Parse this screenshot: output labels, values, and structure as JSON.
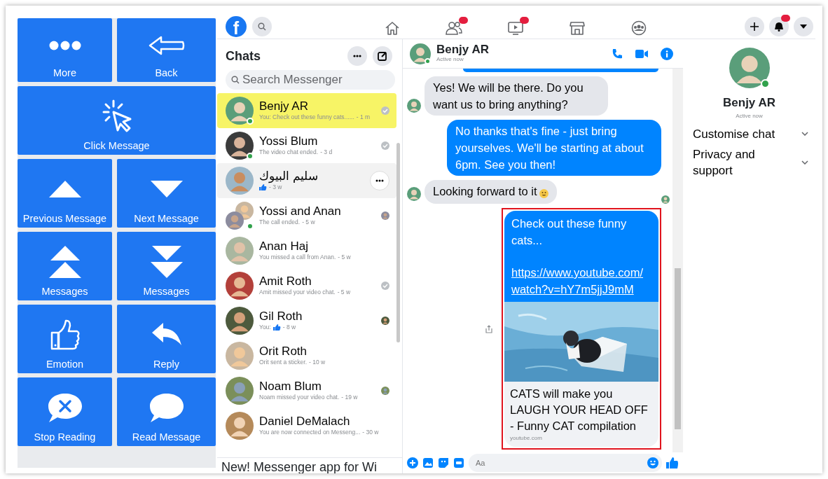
{
  "tool_panel": {
    "buttons": [
      {
        "label": "More",
        "kind": "more"
      },
      {
        "label": "Back",
        "kind": "back"
      },
      {
        "label": "Click Message",
        "kind": "click"
      },
      {
        "label": "Previous Message",
        "kind": "up"
      },
      {
        "label": "Next Message",
        "kind": "down"
      },
      {
        "label": "Messages",
        "kind": "top"
      },
      {
        "label": "Messages",
        "kind": "bottom"
      },
      {
        "label": "Emotion",
        "kind": "like"
      },
      {
        "label": "Reply",
        "kind": "reply"
      },
      {
        "label": "Stop Reading",
        "kind": "stop"
      },
      {
        "label": "Read Message",
        "kind": "read"
      }
    ]
  },
  "top_nav": {
    "logo_text": "f",
    "items": [
      {
        "kind": "home",
        "badge": false
      },
      {
        "kind": "friends",
        "badge": true
      },
      {
        "kind": "watch",
        "badge": true
      },
      {
        "kind": "marketplace",
        "badge": false
      },
      {
        "kind": "groups",
        "badge": false
      }
    ],
    "actions": [
      {
        "kind": "plus",
        "badge": false
      },
      {
        "kind": "bell",
        "badge": true
      },
      {
        "kind": "caret",
        "badge": false
      }
    ]
  },
  "chats": {
    "title": "Chats",
    "search": {
      "placeholder": "Search Messenger"
    },
    "items": [
      {
        "name": "Benjy AR",
        "preview": "You: Check out these funny cats......",
        "like": false,
        "time": "- 1 m",
        "selected": true,
        "hovered": false,
        "online": true,
        "kind": "person",
        "receipt": {
          "kind": "check"
        }
      },
      {
        "name": "Yossi Blum",
        "preview": "The video chat ended.",
        "like": false,
        "time": "- 3 d",
        "selected": false,
        "hovered": false,
        "online": true,
        "kind": "person",
        "receipt": {
          "kind": "check"
        }
      },
      {
        "name": "سليم البيوك",
        "like": true,
        "time": "- 3 w",
        "selected": false,
        "hovered": true,
        "online": false,
        "kind": "person"
      },
      {
        "name": "Yossi and Anan",
        "preview": "The call ended.",
        "like": false,
        "time": "- 5 w",
        "selected": false,
        "hovered": false,
        "online": true,
        "kind": "group",
        "receipt": {
          "kind": "avatar"
        }
      },
      {
        "name": "Anan Haj",
        "preview": "You missed a call from Anan.",
        "like": false,
        "time": "- 5 w",
        "selected": false,
        "hovered": false,
        "online": false,
        "kind": "person"
      },
      {
        "name": "Amit Roth",
        "preview": "Amit missed your video chat.",
        "like": false,
        "time": "- 5 w",
        "selected": false,
        "hovered": false,
        "online": false,
        "kind": "person",
        "receipt": {
          "kind": "check"
        }
      },
      {
        "name": "Gil Roth",
        "preview": "You:",
        "like": true,
        "time": "- 8 w",
        "selected": false,
        "hovered": false,
        "online": false,
        "kind": "person",
        "receipt": {
          "kind": "avatar"
        }
      },
      {
        "name": "Orit Roth",
        "preview": "Orit sent a sticker.",
        "like": false,
        "time": "- 10 w",
        "selected": false,
        "hovered": false,
        "online": false,
        "kind": "person"
      },
      {
        "name": "Noam Blum",
        "preview": "Noam missed your video chat.",
        "like": false,
        "time": "- 19 w",
        "selected": false,
        "hovered": false,
        "online": false,
        "kind": "person",
        "receipt": {
          "kind": "avatar"
        }
      },
      {
        "name": "Daniel DeMalach",
        "preview": "You are now connected on Messeng...",
        "like": false,
        "time": "- 30 w",
        "selected": false,
        "hovered": false,
        "online": false,
        "kind": "person"
      }
    ],
    "banner": "New! Messenger app for Wi"
  },
  "conversation": {
    "name": "Benjy AR",
    "status": "Active now",
    "messages": [
      {
        "kind": "text",
        "outgoing": false,
        "text": "Yes! We will be there. Do you want us to bring anything?",
        "emoji": false,
        "read_receipt": false
      },
      {
        "kind": "text",
        "outgoing": true,
        "text": "No thanks that's fine - just bring yourselves. We'll be starting at about 6pm. See you then!",
        "emoji": false,
        "read_receipt": false
      },
      {
        "kind": "text",
        "outgoing": false,
        "text": "Looking forward to it",
        "emoji": true,
        "read_receipt": true
      },
      {
        "kind": "link",
        "outgoing": true,
        "text": "Check out these funny cats...",
        "url": "https://www.youtube.com/watch?v=hY7m5jjJ9mM",
        "link_title": "CATS will make you LAUGH YOUR HEAD OFF - Funny CAT compilation",
        "link_domain": "youtube.com",
        "highlighted": true
      }
    ],
    "composer": {
      "placeholder": "Aa"
    }
  },
  "profile": {
    "name": "Benjy AR",
    "status": "Active now",
    "online": true,
    "sections": [
      "Customise chat",
      "Privacy and support"
    ]
  }
}
